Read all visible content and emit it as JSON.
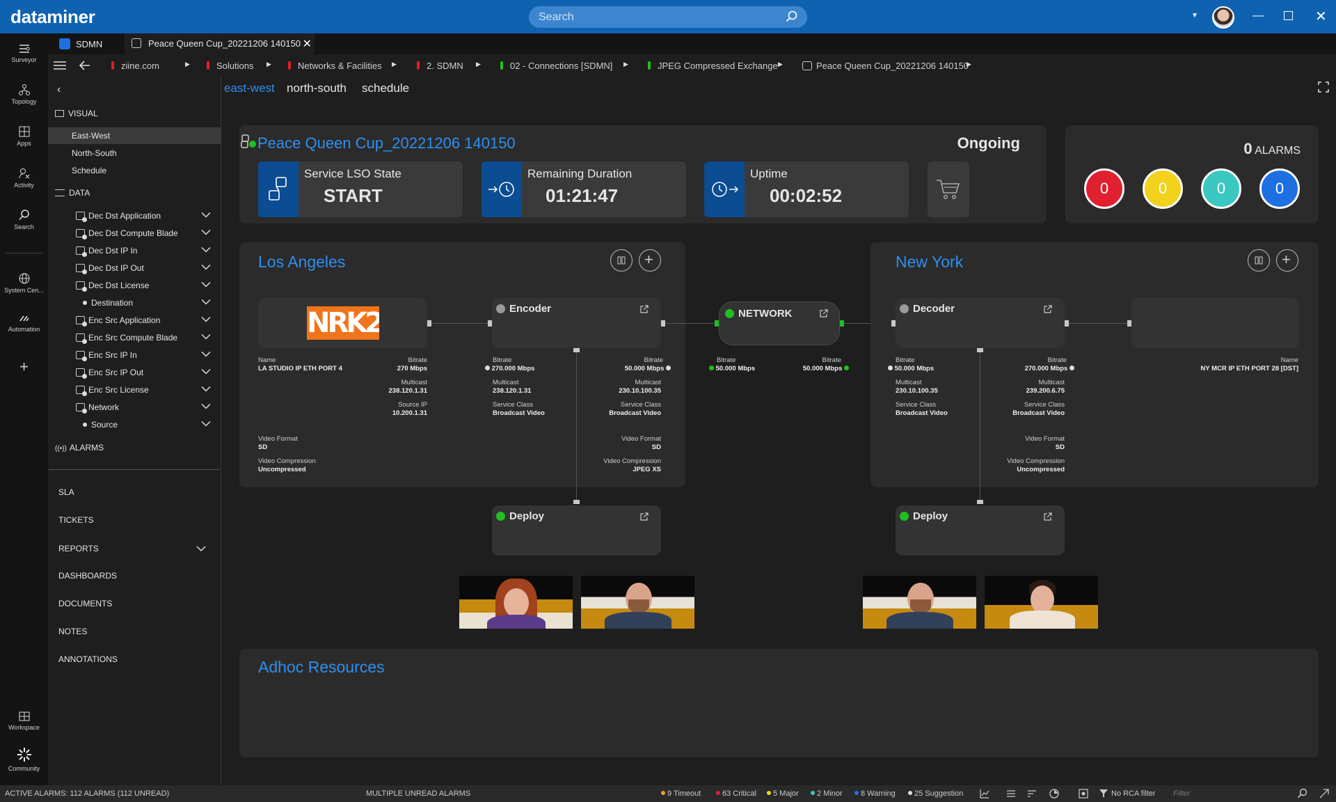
{
  "app": {
    "logo": "dataminer",
    "search_placeholder": "Search"
  },
  "rail": {
    "items": [
      {
        "label": "Surveyor",
        "icon": "surveyor-icon"
      },
      {
        "label": "Topology",
        "icon": "topology-icon"
      },
      {
        "label": "Apps",
        "icon": "apps-icon"
      },
      {
        "label": "Activity",
        "icon": "activity-icon"
      },
      {
        "label": "Search",
        "icon": "search-icon"
      },
      {
        "label": "System Cen...",
        "icon": "globe-icon"
      },
      {
        "label": "Automation",
        "icon": "automation-icon"
      },
      {
        "label": "Workspace",
        "icon": "workspace-icon"
      },
      {
        "label": "Community",
        "icon": "community-icon"
      }
    ]
  },
  "tabs": [
    {
      "label": "SDMN"
    },
    {
      "label": "Peace Queen Cup_20221206 140150"
    }
  ],
  "breadcrumb": [
    {
      "label": "ziine.com",
      "color": "#e02020"
    },
    {
      "label": "Solutions",
      "color": "#e02020"
    },
    {
      "label": "Networks & Facilities",
      "color": "#e02020"
    },
    {
      "label": "2. SDMN",
      "color": "#e02020"
    },
    {
      "label": "02 - Connections [SDMN]",
      "color": "#20c020"
    },
    {
      "label": "JPEG Compressed Exchange",
      "color": "#20c020"
    },
    {
      "label": "Peace Queen Cup_20221206 140150",
      "color": ""
    }
  ],
  "nav": {
    "visual_header": "VISUAL",
    "visual_items": [
      "East-West",
      "North-South",
      "Schedule"
    ],
    "data_header": "DATA",
    "data_items": [
      {
        "label": "Dec Dst Application",
        "icon": "box"
      },
      {
        "label": "Dec Dst Compute Blade",
        "icon": "box"
      },
      {
        "label": "Dec Dst IP In",
        "icon": "box"
      },
      {
        "label": "Dec Dst IP Out",
        "icon": "box"
      },
      {
        "label": "Dec Dst License",
        "icon": "box"
      },
      {
        "label": "Destination",
        "icon": "dot"
      },
      {
        "label": "Enc Src Application",
        "icon": "box"
      },
      {
        "label": "Enc Src Compute Blade",
        "icon": "box"
      },
      {
        "label": "Enc Src IP In",
        "icon": "box"
      },
      {
        "label": "Enc Src IP Out",
        "icon": "box"
      },
      {
        "label": "Enc Src License",
        "icon": "box"
      },
      {
        "label": "Network",
        "icon": "net"
      },
      {
        "label": "Source",
        "icon": "dot"
      }
    ],
    "alarms_header": "ALARMS",
    "lower_items": [
      "SLA",
      "TICKETS",
      "REPORTS",
      "DASHBOARDS",
      "DOCUMENTS",
      "NOTES",
      "ANNOTATIONS"
    ]
  },
  "view_tabs": [
    "east-west",
    "north-south",
    "schedule"
  ],
  "service": {
    "name": "Peace Queen Cup_20221206 140150",
    "state": "Ongoing",
    "lso_label": "Service LSO State",
    "lso_value": "START",
    "remaining_label": "Remaining Duration",
    "remaining_value": "01:21:47",
    "uptime_label": "Uptime",
    "uptime_value": "00:02:52"
  },
  "alarms": {
    "count": "0",
    "label": "ALARMS",
    "circles": [
      {
        "value": "0",
        "color": "#e0202e"
      },
      {
        "value": "0",
        "color": "#f2d21c"
      },
      {
        "value": "0",
        "color": "#3ac8c0"
      },
      {
        "value": "0",
        "color": "#1e6fe0"
      }
    ]
  },
  "la": {
    "title": "Los Angeles",
    "logo": "NRK2",
    "source": {
      "name_label": "Name",
      "name": "LA STUDIO  IP ETH PORT 4",
      "bitrate_label": "Bitrate",
      "bitrate": "270 Mbps",
      "multicast_label": "Multicast",
      "multicast": "238.120.1.31",
      "sourceip_label": "Source IP",
      "sourceip": "10.200.1.31",
      "vf_label": "Video Format",
      "vf": "SD",
      "vc_label": "Video Compression",
      "vc": "Uncompressed"
    },
    "encoder": {
      "title": "Encoder",
      "in_bitrate_label": "Bitrate",
      "in_bitrate": "270.000 Mbps",
      "in_multicast_label": "Multicast",
      "in_multicast": "238.120.1.31",
      "in_sc_label": "Service Class",
      "in_sc": "Broadcast Video",
      "out_bitrate_label": "Bitrate",
      "out_bitrate": "50.000 Mbps",
      "out_multicast_label": "Multicast",
      "out_multicast": "230.10.100.35",
      "out_sc_label": "Service Class",
      "out_sc": "Broadcast Video",
      "vf_label": "Video Format",
      "vf": "SD",
      "vc_label": "Video Compression",
      "vc": "JPEG XS"
    },
    "deploy": "Deploy"
  },
  "network": {
    "title": "NETWORK",
    "in_bitrate_label": "Bitrate",
    "in_bitrate": "50.000 Mbps",
    "out_bitrate_label": "Bitrate",
    "out_bitrate": "50.000 Mbps"
  },
  "ny": {
    "title": "New York",
    "decoder": {
      "title": "Decoder",
      "in_bitrate_label": "Bitrate",
      "in_bitrate": "50.000 Mbps",
      "in_multicast_label": "Multicast",
      "in_multicast": "230.10.100.35",
      "in_sc_label": "Service Class",
      "in_sc": "Broadcast Video",
      "out_bitrate_label": "Bitrate",
      "out_bitrate": "270.000 Mbps",
      "out_multicast_label": "Multicast",
      "out_multicast": "239.200.6.75",
      "out_sc_label": "Service Class",
      "out_sc": "Broadcast Video",
      "vf_label": "Video Format",
      "vf": "SD",
      "vc_label": "Video Compression",
      "vc": "Uncompressed"
    },
    "dest": {
      "name_label": "Name",
      "name": "NY MCR IP ETH PORT 28 [DST]"
    },
    "deploy": "Deploy"
  },
  "adhoc": {
    "title": "Adhoc Resources"
  },
  "statusbar": {
    "active": "ACTIVE ALARMS: 112 ALARMS (112 UNREAD)",
    "unread": "MULTIPLE UNREAD ALARMS",
    "counts": [
      {
        "label": "9 Timeout",
        "color": "#f0a020"
      },
      {
        "label": "63 Critical",
        "color": "#e0202e"
      },
      {
        "label": "5 Major",
        "color": "#f2d21c"
      },
      {
        "label": "2 Minor",
        "color": "#3ac8c0"
      },
      {
        "label": "8 Warning",
        "color": "#1e6fe0"
      },
      {
        "label": "25 Suggestion",
        "color": "#dddddd"
      }
    ],
    "rca": "No RCA filter",
    "filter_placeholder": "Filter"
  }
}
